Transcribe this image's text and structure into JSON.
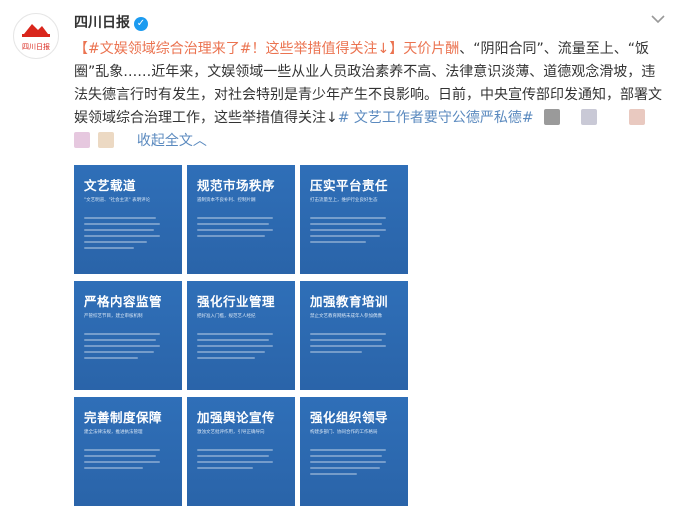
{
  "post": {
    "author": "四川日报",
    "verified_glyph": "✓",
    "avatar_text": "四川日报",
    "content": {
      "topic1": "【#文娱领域综合治理来了#！这些举措值得关注↓】",
      "link1": "天价片酬",
      "text_a": "、“阴阳合同”、流量至上、“饭圈”乱象……近年来，文娱领域一些从业人员政治素养不高、法律意识淡薄、道德观念滑坡，违法失德言行时有发生，对社会特别是青少年产生不良影响。日前，中央宣传部印发通知，部署文娱领域综合治理工作，这些举措值得关注↓",
      "topic2": "# 文艺工作者要守公德严私德#",
      "collapse": "收起全文",
      "collapse_arrow": "︿"
    }
  },
  "tiles": [
    {
      "title": "文艺载道",
      "subtitle": "\"文艺明道、\"社会主流\" 表明评论"
    },
    {
      "title": "规范市场秩序",
      "subtitle": "遏制资本不良补利、控制片酬"
    },
    {
      "title": "压实平台责任",
      "subtitle": "打击流量至上，维护行业良好生态"
    },
    {
      "title": "严格内容监管",
      "subtitle": "严管综艺节目，建立审核机制"
    },
    {
      "title": "强化行业管理",
      "subtitle": "把好准入门槛，规范艺人经纪"
    },
    {
      "title": "加强教育培训",
      "subtitle": "禁止文艺教育网络未成年人参加偶像"
    },
    {
      "title": "完善制度保障",
      "subtitle": "建全法律法规，推进执法管理"
    },
    {
      "title": "加强舆论宣传",
      "subtitle": "激浊文艺批评作用，引导正确导向"
    },
    {
      "title": "强化组织领导",
      "subtitle": "构建多部门、协同合作的工作格局"
    }
  ],
  "colors": {
    "topic": "#eb7350",
    "link": "#5b8abf",
    "tile": "#2f6fb8"
  }
}
